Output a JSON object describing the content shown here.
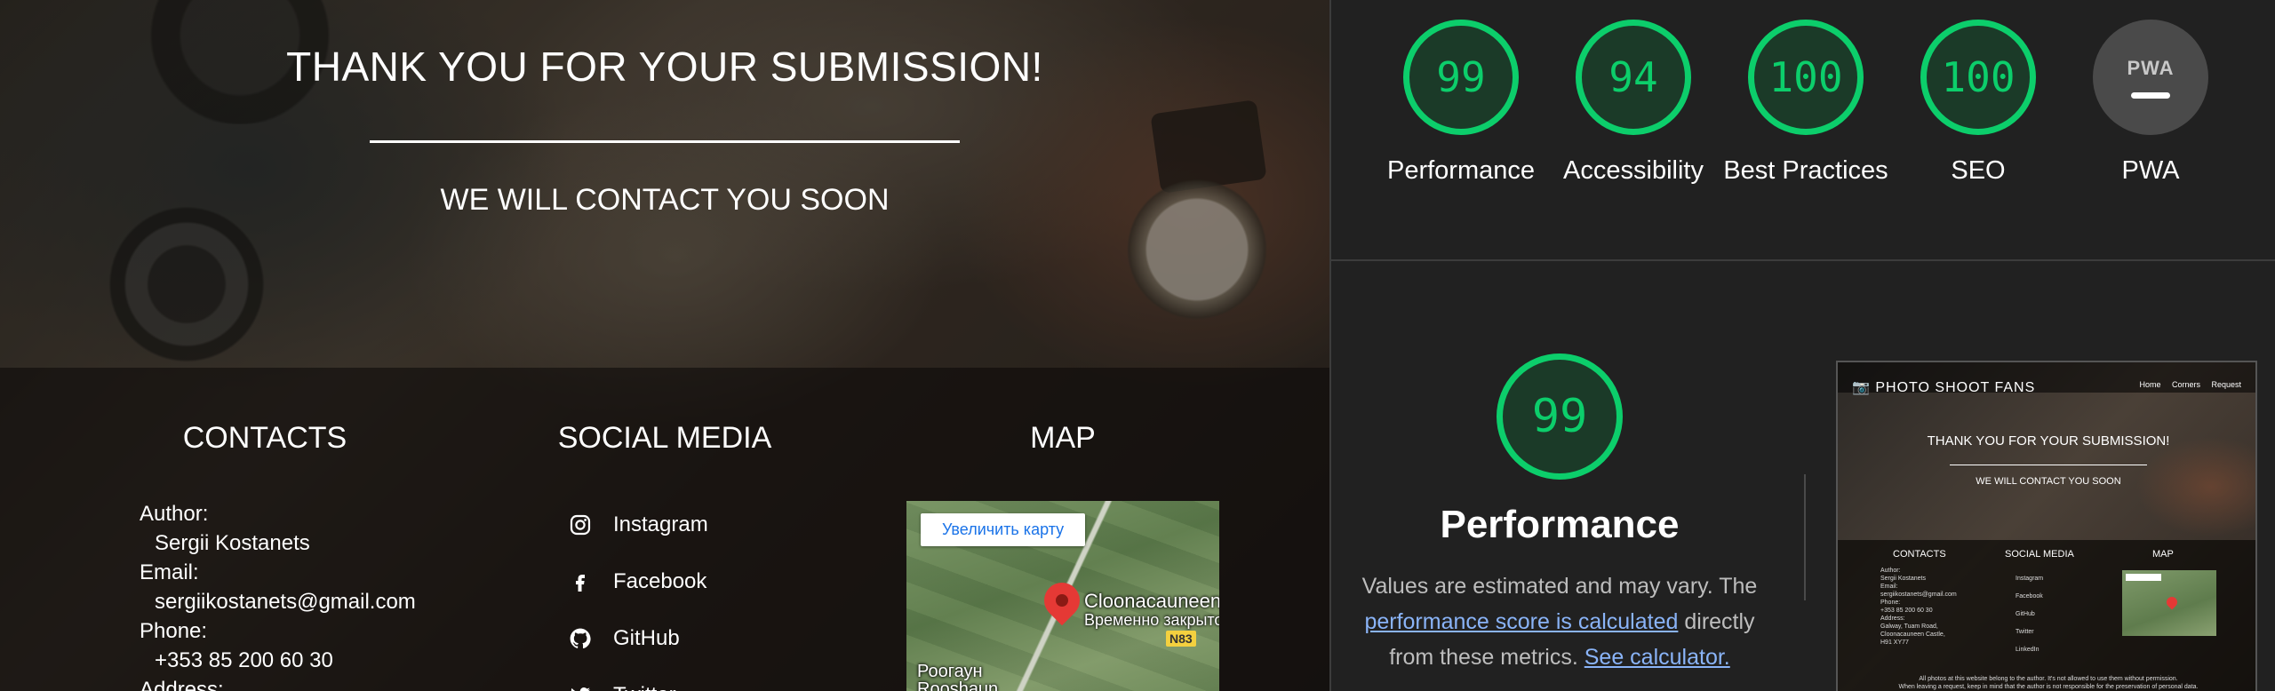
{
  "site": {
    "hero_title": "THANK YOU FOR YOUR SUBMISSION!",
    "hero_subtitle": "WE WILL CONTACT YOU SOON",
    "contacts": {
      "heading": "CONTACTS",
      "author_label": "Author:",
      "author_value": "Sergii Kostanets",
      "email_label": "Email:",
      "email_value": "sergiikostanets@gmail.com",
      "phone_label": "Phone:",
      "phone_value": "+353 85 200 60 30",
      "address_label": "Address:"
    },
    "social": {
      "heading": "SOCIAL MEDIA",
      "items": [
        {
          "label": "Instagram",
          "icon": "instagram-icon"
        },
        {
          "label": "Facebook",
          "icon": "facebook-icon"
        },
        {
          "label": "GitHub",
          "icon": "github-icon"
        },
        {
          "label": "Twitter",
          "icon": "twitter-icon"
        }
      ]
    },
    "map": {
      "heading": "MAP",
      "enlarge_button": "Увеличить карту",
      "place_name": "Cloonacauneen",
      "place_status": "Временно закрыто",
      "road_label": "N83",
      "town_line1": "Роогаун",
      "town_line2": "Rooshaun"
    }
  },
  "lighthouse": {
    "scores": [
      {
        "label": "Performance",
        "value": "99",
        "color": "#0cce6b"
      },
      {
        "label": "Accessibility",
        "value": "94",
        "color": "#0cce6b"
      },
      {
        "label": "Best Practices",
        "value": "100",
        "color": "#0cce6b"
      },
      {
        "label": "SEO",
        "value": "100",
        "color": "#0cce6b"
      },
      {
        "label": "PWA",
        "value": "PWA",
        "color": "#4a4a4a"
      }
    ],
    "detail": {
      "score": "99",
      "title": "Performance",
      "note_prefix": "Values are estimated and may vary. The",
      "note_link": "performance score is calculated",
      "note_middle": "directly from these metrics.",
      "note_link2": "See calculator."
    },
    "thumbnail": {
      "brand": "📷 PHOTO SHOOT FANS",
      "nav_links": "Home Corners Request",
      "title": "THANK YOU FOR YOUR SUBMISSION!",
      "subtitle": "WE WILL CONTACT YOU SOON",
      "col_contacts": "CONTACTS",
      "col_social": "SOCIAL MEDIA",
      "col_map": "MAP",
      "contacts_text": "Author:\nSergii Kostanets\nEmail:\nsergiikostanets@gmail.com\nPhone:\n+353 85 200 60 30\nAddress:\nGalway, Tuam Road,\nCloonacauneen Castle,\nH91 XY77",
      "social_text": "Instagram\nFacebook\nGitHub\nTwitter\nLinkedIn",
      "footer_text": "All photos at this website belong to the author. It's not allowed to use them without permission.\nWhen leaving a request, keep in mind that the author is not responsible for the preservation of personal data."
    }
  }
}
